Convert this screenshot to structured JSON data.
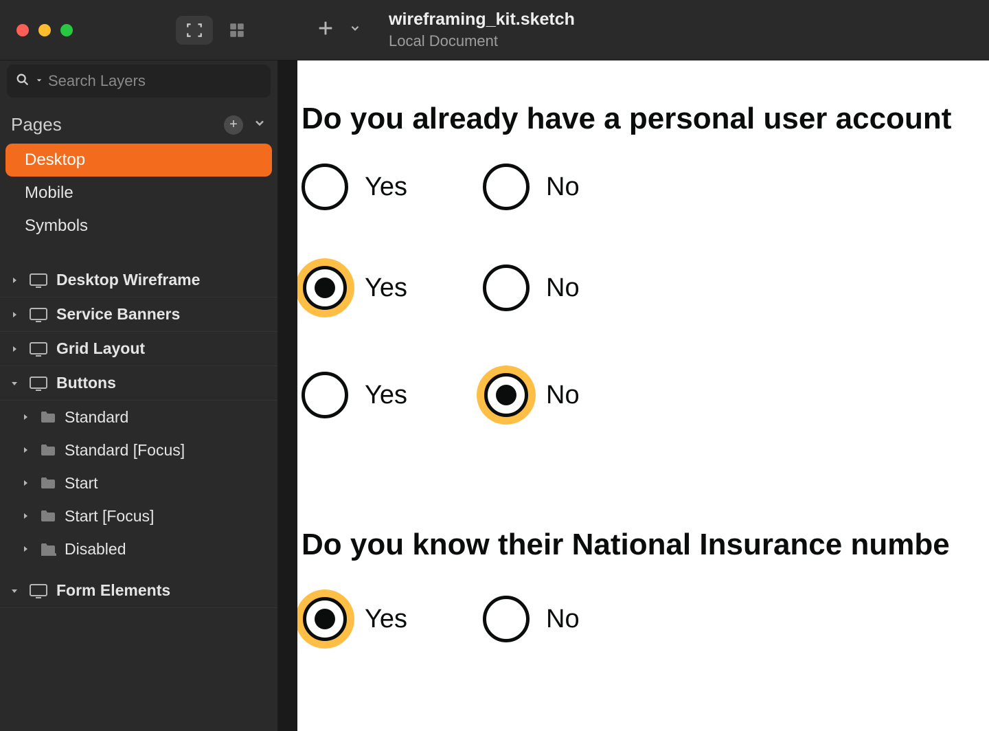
{
  "document": {
    "title": "wireframing_kit.sketch",
    "subtitle": "Local Document"
  },
  "search": {
    "placeholder": "Search Layers"
  },
  "pages": {
    "title": "Pages",
    "items": [
      "Desktop",
      "Mobile",
      "Symbols"
    ]
  },
  "layers": {
    "artboards": [
      {
        "name": "Desktop Wireframe",
        "expanded": false
      },
      {
        "name": "Service Banners",
        "expanded": false
      },
      {
        "name": "Grid Layout",
        "expanded": false
      },
      {
        "name": "Buttons",
        "expanded": true,
        "children": [
          "Standard",
          "Standard [Focus]",
          "Start",
          "Start [Focus]",
          "Disabled"
        ]
      },
      {
        "name": "Form Elements",
        "expanded": true
      }
    ]
  },
  "canvas": {
    "q1": "Do you already have a personal user  account",
    "q2": "Do you know their National Insurance numbe",
    "yes": "Yes",
    "no": "No"
  },
  "colors": {
    "accent": "#f36b1c",
    "focus": "#ffbf47"
  }
}
